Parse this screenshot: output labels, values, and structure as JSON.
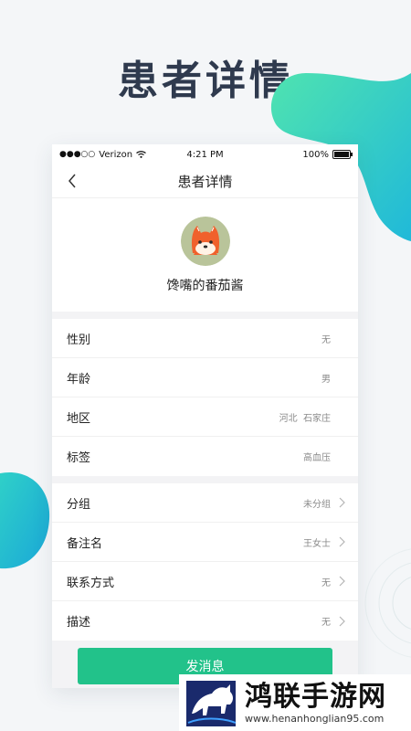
{
  "headline": "患者详情",
  "status_bar": {
    "carrier": "Verizon",
    "time": "4:21 PM",
    "battery": "100%"
  },
  "nav": {
    "title": "患者详情"
  },
  "profile": {
    "nickname": "馋嘴的番茄酱"
  },
  "info_section": [
    {
      "label": "性别",
      "value": "无"
    },
    {
      "label": "年龄",
      "value": "男"
    },
    {
      "label": "地区",
      "value": "河北  石家庄"
    },
    {
      "label": "标签",
      "value": "高血压"
    }
  ],
  "manage_section": [
    {
      "label": "分组",
      "value": "未分组"
    },
    {
      "label": "备注名",
      "value": "王女士"
    },
    {
      "label": "联系方式",
      "value": "无"
    },
    {
      "label": "描述",
      "value": "无"
    }
  ],
  "send_button": "发消息",
  "watermark": {
    "title": "鸿联手游网",
    "url": "www.henanhonglian95.com"
  },
  "colors": {
    "accent": "#22c28a",
    "headline": "#2f3a4e"
  }
}
